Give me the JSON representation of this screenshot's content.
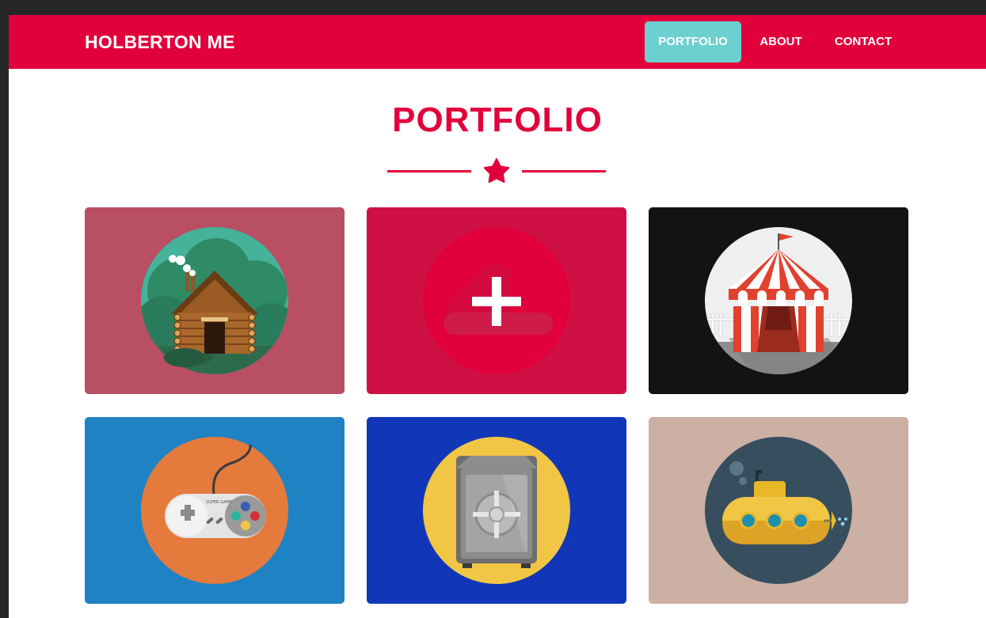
{
  "navbar": {
    "brand": "HOLBERTON ME",
    "links": [
      {
        "label": "PORTFOLIO",
        "active": true
      },
      {
        "label": "ABOUT",
        "active": false
      },
      {
        "label": "CONTACT",
        "active": false
      }
    ]
  },
  "section": {
    "title": "PORTFOLIO",
    "divider_icon": "star-icon"
  },
  "portfolio": [
    {
      "icon": "log-cabin-icon",
      "background": "#b84f63",
      "circle": "#44b39a"
    },
    {
      "icon": "plus-icon",
      "background": "#cf1044",
      "circle": "#e1003b",
      "hover_overlay": true
    },
    {
      "icon": "circus-tent-icon",
      "background": "#151212",
      "circle": "#eef0f0"
    },
    {
      "icon": "game-controller-icon",
      "background": "#1f83c3",
      "circle": "#e57a3d"
    },
    {
      "icon": "safe-icon",
      "background": "#1137b8",
      "circle": "#f1c645"
    },
    {
      "icon": "submarine-icon",
      "background": "#cbb0a3",
      "circle": "#374e5f"
    }
  ],
  "colors": {
    "brand_red": "#e1003b",
    "active_nav": "#6ccfd0",
    "frame": "#262626"
  }
}
